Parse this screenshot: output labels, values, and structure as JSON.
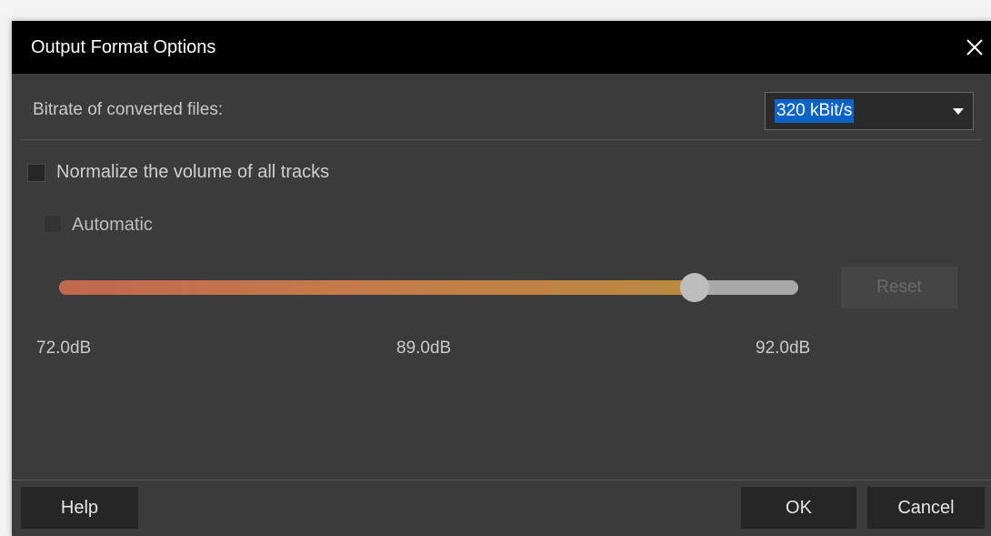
{
  "dialog": {
    "title": "Output Format Options"
  },
  "bitrate": {
    "label": "Bitrate of converted files:",
    "selected": "320 kBit/s"
  },
  "normalize": {
    "label": "Normalize the volume of all tracks",
    "checked": false
  },
  "automatic": {
    "label": "Automatic",
    "checked": false,
    "enabled": false
  },
  "volume_slider": {
    "min": 72.0,
    "max": 92.0,
    "value": 89.0,
    "min_label": "72.0dB",
    "mid_label": "89.0dB",
    "max_label": "92.0dB",
    "fill_colors": [
      "#c0684f",
      "#b98a3f"
    ],
    "track_color": "#a8a8a8"
  },
  "buttons": {
    "reset": "Reset",
    "help": "Help",
    "ok": "OK",
    "cancel": "Cancel"
  },
  "icons": {
    "close": "close-icon",
    "dropdown": "chevron-down-icon"
  }
}
